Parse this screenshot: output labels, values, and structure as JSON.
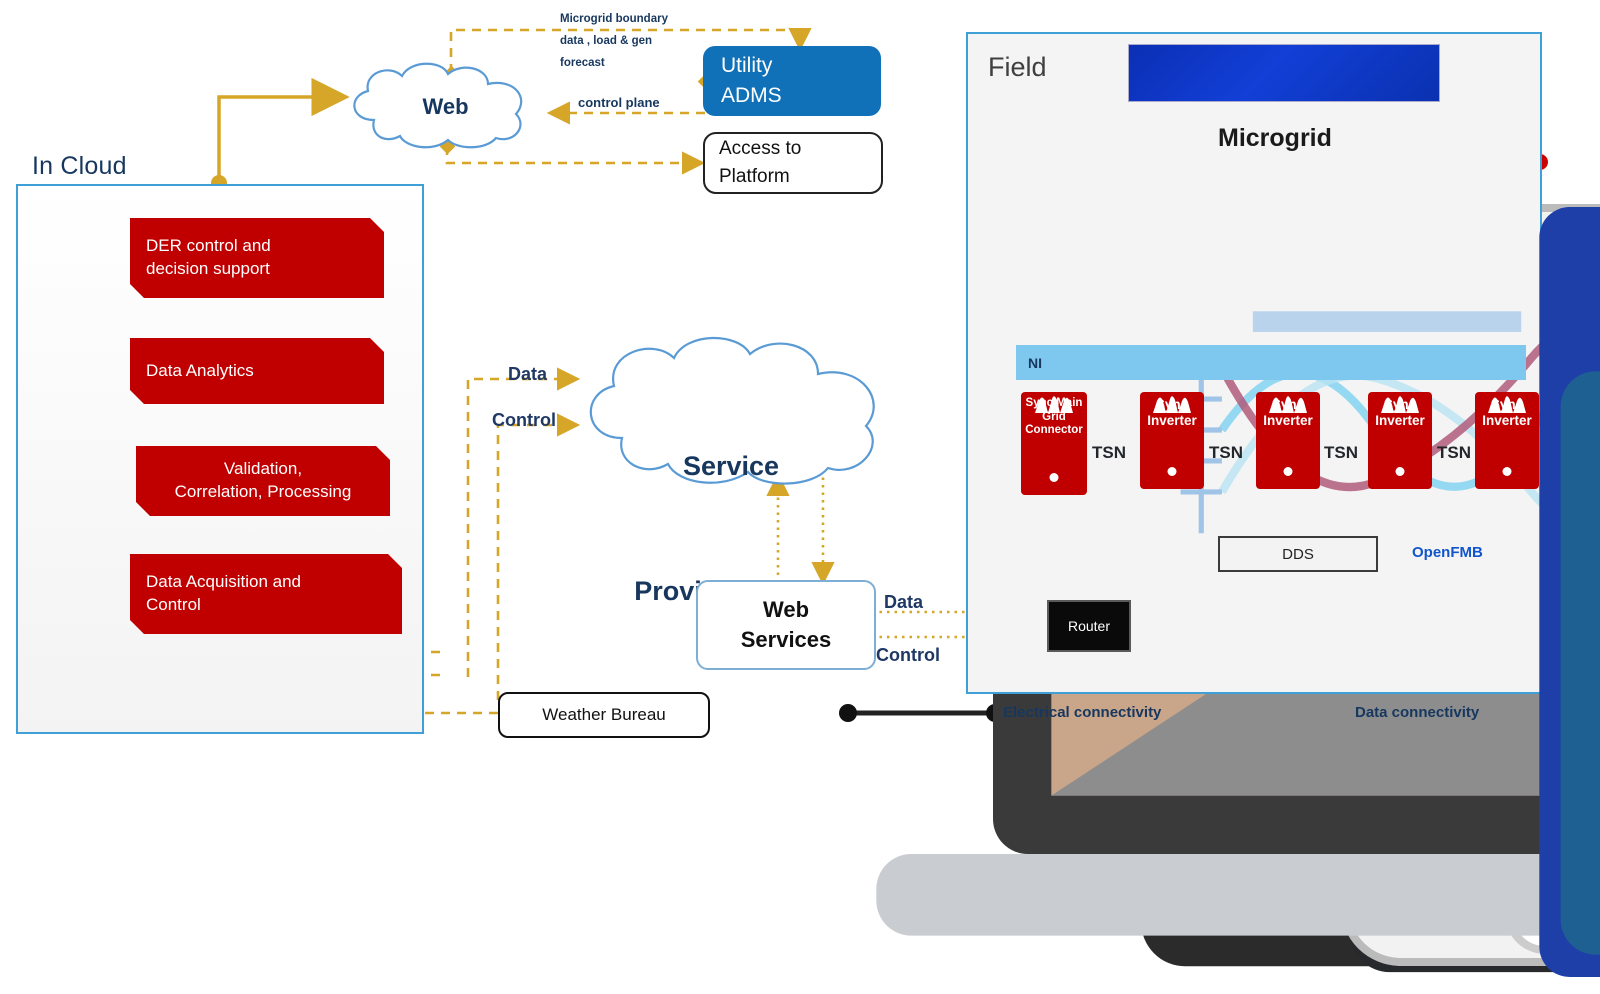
{
  "cloud_section": {
    "title": "In Cloud",
    "stack": [
      {
        "label": "DER control and\ndecision support"
      },
      {
        "label": "Data Analytics"
      },
      {
        "label": "Validation,\nCorrelation, Processing"
      },
      {
        "label": "Data Acquisition and\nControl"
      }
    ]
  },
  "web": {
    "label": "Web",
    "note_lines": "Microgrid boundary\ndata , load & gen\nforecast",
    "control_plane_label": "control plane"
  },
  "adms": {
    "line1": "Utility",
    "line2": "ADMS"
  },
  "access_platform": {
    "line1": "Access to",
    "line2": "Platform"
  },
  "devices": [
    {
      "name": "tablet"
    },
    {
      "name": "smartphone-black"
    },
    {
      "name": "smartphone-white"
    },
    {
      "name": "laptop"
    }
  ],
  "service_cloud": {
    "line1": "Service",
    "line2": "Provider Cloud",
    "data_label": "Data",
    "control_label": "Control"
  },
  "web_services": {
    "line1": "Web",
    "line2": "Services",
    "data_label": "Data",
    "control_label": "Control"
  },
  "weather_bureau": {
    "label": "Weather Bureau"
  },
  "field": {
    "title": "Field",
    "microgrid_title": "Microgrid",
    "ni_label": "NI",
    "openfmb_label": "OpenFMB",
    "dds_label": "DDS",
    "router_label": "Router",
    "tsn_label": "TSN",
    "tsn_count": 4,
    "assets": [
      {
        "icon": "transmission-tower-icon",
        "controller": "Sync Main\nGrid\nConnector",
        "flow": "down"
      },
      {
        "icon": "battery-icon",
        "controller": "Sync\nInverter",
        "flow": "down"
      },
      {
        "icon": "solar-pv-icon",
        "controller": "Sync\nInverter",
        "flow": "down"
      },
      {
        "icon": "wind-turbine-icon",
        "controller": "Sync\nInverter",
        "flow": "down"
      },
      {
        "icon": "motor-icon",
        "controller": "Sync\nInverter",
        "flow": "up"
      }
    ]
  },
  "legend": {
    "electrical": "Electrical connectivity",
    "data": "Data connectivity"
  },
  "colors": {
    "red_box": "#c00000",
    "panel_border": "#3fa0d8",
    "gold_dashed": "#d6a629",
    "adms_blue": "#1071b8",
    "navy_text": "#17375e",
    "ni_band": "#7ec8f0",
    "bus_red": "#cc0000"
  }
}
